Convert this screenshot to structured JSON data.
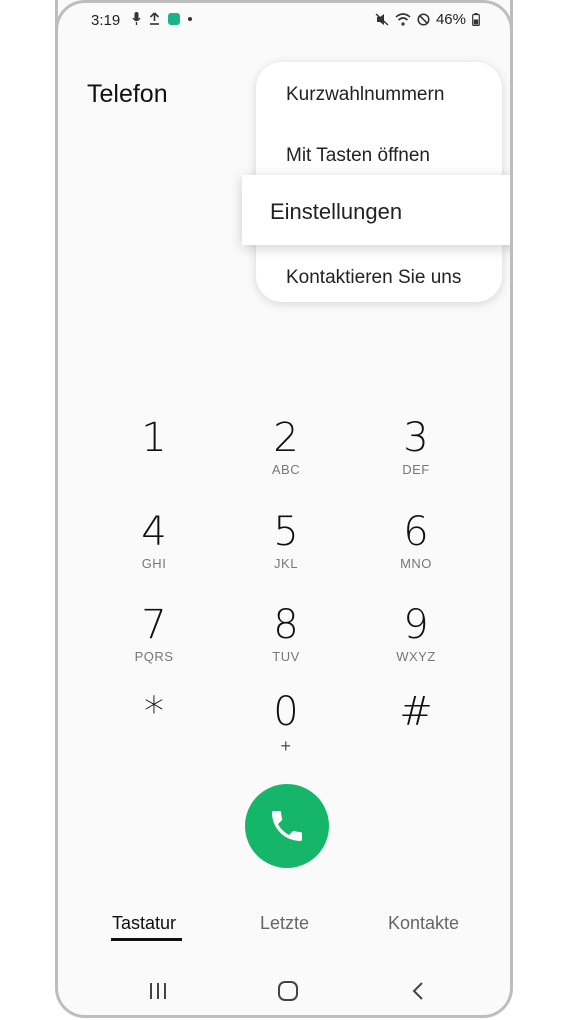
{
  "status_bar": {
    "time": "3:19",
    "battery": "46%",
    "left_icons": [
      "mic-icon",
      "upload-icon",
      "app-badge-icon",
      "notification-dot-icon"
    ],
    "right_icons": [
      "mute-icon",
      "wifi-icon",
      "do-not-disturb-icon",
      "battery-icon"
    ]
  },
  "header": {
    "title": "Telefon"
  },
  "overflow_menu": {
    "items": [
      {
        "label": "Kurzwahlnummern"
      },
      {
        "label": "Mit Tasten öffnen"
      },
      {
        "label": "Einstellungen",
        "highlighted": true
      },
      {
        "label": "Kontaktieren Sie uns"
      }
    ]
  },
  "keypad": {
    "keys": [
      {
        "digit": "1",
        "letters": ""
      },
      {
        "digit": "2",
        "letters": "ABC"
      },
      {
        "digit": "3",
        "letters": "DEF"
      },
      {
        "digit": "4",
        "letters": "GHI"
      },
      {
        "digit": "5",
        "letters": "JKL"
      },
      {
        "digit": "6",
        "letters": "MNO"
      },
      {
        "digit": "7",
        "letters": "PQRS"
      },
      {
        "digit": "8",
        "letters": "TUV"
      },
      {
        "digit": "9",
        "letters": "WXYZ"
      },
      {
        "digit": "*",
        "letters": ""
      },
      {
        "digit": "0",
        "letters": "+"
      },
      {
        "digit": "#",
        "letters": ""
      }
    ]
  },
  "call_button": {
    "icon": "phone-icon",
    "color": "#16b66a"
  },
  "tabs": [
    {
      "label": "Tastatur",
      "active": true
    },
    {
      "label": "Letzte",
      "active": false
    },
    {
      "label": "Kontakte",
      "active": false
    }
  ],
  "nav_bar": {
    "icons": [
      "recents-icon",
      "home-icon",
      "back-icon"
    ]
  }
}
